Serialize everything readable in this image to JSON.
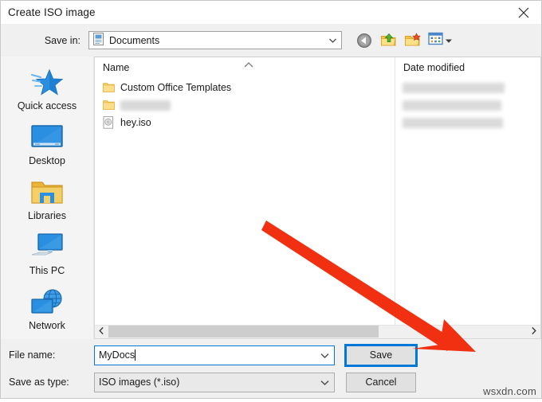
{
  "window": {
    "title": "Create ISO image",
    "close_icon": "close-icon"
  },
  "toolbar": {
    "save_in_label": "Save in:",
    "save_in_value": "Documents",
    "save_in_icon": "documents-icon",
    "chevron_icon": "chevron-down-icon",
    "buttons": [
      {
        "name": "back-button",
        "icon": "back-arrow-icon"
      },
      {
        "name": "up-one-level-button",
        "icon": "folder-up-arrow-icon"
      },
      {
        "name": "new-folder-button",
        "icon": "new-folder-icon"
      },
      {
        "name": "views-button",
        "icon": "views-grid-icon"
      }
    ]
  },
  "sidebar": {
    "items": [
      {
        "label": "Quick access",
        "icon": "quick-access-star-icon"
      },
      {
        "label": "Desktop",
        "icon": "desktop-monitor-icon"
      },
      {
        "label": "Libraries",
        "icon": "libraries-folder-icon"
      },
      {
        "label": "This PC",
        "icon": "this-pc-icon"
      },
      {
        "label": "Network",
        "icon": "network-globe-icon"
      }
    ]
  },
  "file_list": {
    "columns": [
      {
        "label": "Name",
        "sort_icon": "sort-ascending-icon"
      },
      {
        "label": "Date modified"
      }
    ],
    "rows": [
      {
        "name": "Custom Office Templates",
        "icon": "folder-icon",
        "redacted": false,
        "date_redacted": true
      },
      {
        "name": "",
        "icon": "folder-icon",
        "redacted": true,
        "redacted_width": 60,
        "date_redacted": true
      },
      {
        "name": "hey.iso",
        "icon": "disc-image-file-icon",
        "redacted": false,
        "date_redacted": true
      }
    ],
    "scrollbar": {
      "left_icon": "chevron-left-icon",
      "right_icon": "chevron-right-icon"
    }
  },
  "footer": {
    "file_name_label": "File name:",
    "file_name_value": "MyDocs",
    "save_as_type_label": "Save as type:",
    "save_as_type_value": "ISO images (*.iso)",
    "chevron_icon": "chevron-down-icon",
    "save_button": "Save",
    "cancel_button": "Cancel"
  },
  "annotation": {
    "arrow_color": "#f03010",
    "arrow_name": "red-pointer-arrow"
  },
  "watermark": {
    "text": "wsxdn.com"
  },
  "colors": {
    "accent": "#0078d7",
    "chrome": "#f0f0f0",
    "sidebar": "#f4f4f4",
    "folder": "#f7cb53"
  }
}
